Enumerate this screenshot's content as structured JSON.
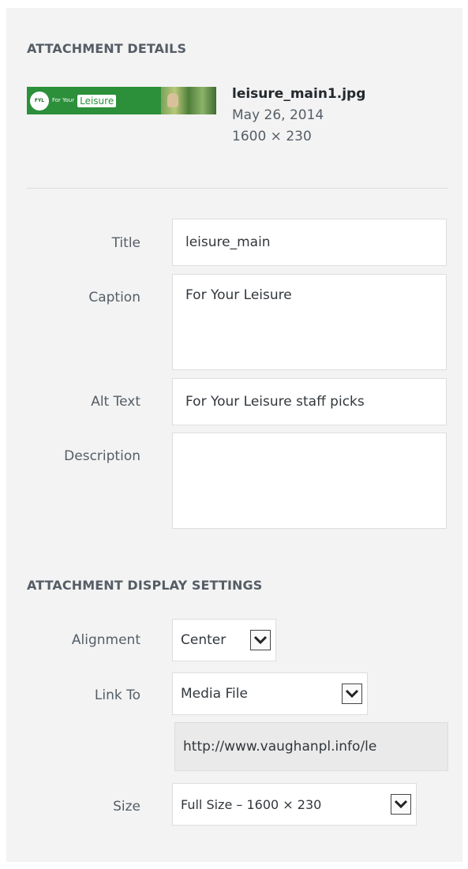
{
  "attachment_details": {
    "heading": "ATTACHMENT DETAILS",
    "thumbnail": {
      "badge_text": "FYL",
      "small_text": "For Your",
      "brand_text": "Leisure"
    },
    "file_name": "leisure_main1.jpg",
    "date": "May 26, 2014",
    "dimensions": "1600 × 230",
    "fields": {
      "title": {
        "label": "Title",
        "value": "leisure_main"
      },
      "caption": {
        "label": "Caption",
        "value": "For Your Leisure"
      },
      "alt_text": {
        "label": "Alt Text",
        "value": "For Your Leisure staff picks"
      },
      "description": {
        "label": "Description",
        "value": ""
      }
    }
  },
  "display_settings": {
    "heading": "ATTACHMENT DISPLAY SETTINGS",
    "alignment": {
      "label": "Alignment",
      "value": "Center"
    },
    "link_to": {
      "label": "Link To",
      "value": "Media File",
      "url": "http://www.vaughanpl.info/le"
    },
    "size": {
      "label": "Size",
      "value": "Full Size – 1600 × 230"
    }
  },
  "icons": {
    "dropdown": "chevron-down-icon"
  },
  "colors": {
    "panel_bg": "#f3f3f3",
    "brand_green": "#2c8f3a",
    "text_dark": "#23282d",
    "text_muted": "#555d66"
  }
}
